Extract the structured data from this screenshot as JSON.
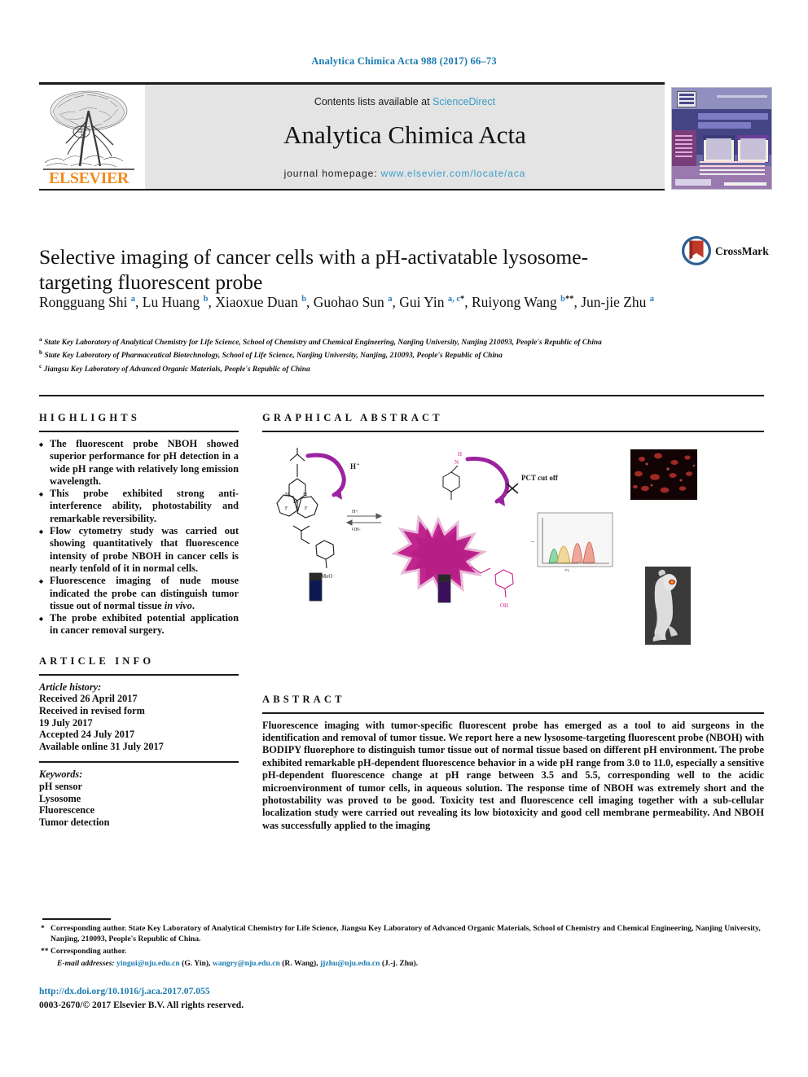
{
  "running_head": "Analytica Chimica Acta 988 (2017) 66–73",
  "masthead": {
    "publisher": "ELSEVIER",
    "contents_prefix": "Contents lists available at ",
    "contents_link": "ScienceDirect",
    "journal_name": "Analytica Chimica Acta",
    "homepage_prefix": "journal homepage: ",
    "homepage_link": "www.elsevier.com/locate/aca"
  },
  "crossmark": {
    "label": "CrossMark"
  },
  "article": {
    "title": "Selective imaging of cancer cells with a pH-activatable lysosome-targeting fluorescent probe",
    "authors": [
      {
        "name": "Rongguang Shi",
        "marks": "a",
        "sep": ", "
      },
      {
        "name": "Lu Huang",
        "marks": "b",
        "sep": ", "
      },
      {
        "name": "Xiaoxue Duan",
        "marks": "b",
        "sep": ", "
      },
      {
        "name": "Guohao Sun",
        "marks": "a",
        "sep": ", "
      },
      {
        "name": "Gui Yin",
        "marks": "a, c",
        "star": "*",
        "sep": ", "
      },
      {
        "name": "Ruiyong Wang",
        "marks": "b",
        "star": "**",
        "sep": ", "
      },
      {
        "name": "Jun-jie Zhu",
        "marks": "a",
        "sep": ""
      }
    ],
    "affiliations": [
      {
        "mark": "a",
        "text": "State Key Laboratory of Analytical Chemistry for Life Science, School of Chemistry and Chemical Engineering, Nanjing University, Nanjing 210093, People's Republic of China"
      },
      {
        "mark": "b",
        "text": "State Key Laboratory of Pharmaceutical Biotechnology, School of Life Science, Nanjing University, Nanjing, 210093, People's Republic of China"
      },
      {
        "mark": "c",
        "text": "Jiangsu Key Laboratory of Advanced Organic Materials, People's Republic of China"
      }
    ]
  },
  "highlights": {
    "heading": "HIGHLIGHTS",
    "items": [
      "The fluorescent probe NBOH showed superior performance for pH detection in a wide pH range with relatively long emission wavelength.",
      "This probe exhibited strong anti-interference ability, photostability and remarkable reversibility.",
      "Flow cytometry study was carried out showing quantitatively that fluorescence intensity of probe NBOH in cancer cells is nearly tenfold of it in normal cells.",
      "Fluorescence imaging of nude mouse indicated the probe can distinguish tumor tissue out of normal tissue in vivo.",
      "The probe exhibited potential application in cancer removal surgery."
    ]
  },
  "graphical_abstract": {
    "heading": "GRAPHICAL ABSTRACT"
  },
  "article_info": {
    "heading": "ARTICLE INFO",
    "history_label": "Article history:",
    "history": [
      "Received 26 April 2017",
      "Received in revised form",
      "19 July 2017",
      "Accepted 24 July 2017",
      "Available online 31 July 2017"
    ],
    "keywords_label": "Keywords:",
    "keywords": [
      "pH sensor",
      "Lysosome",
      "Fluorescence",
      "Tumor detection"
    ]
  },
  "abstract": {
    "heading": "ABSTRACT",
    "text": "Fluorescence imaging with tumor-specific fluorescent probe has emerged as a tool to aid surgeons in the identification and removal of tumor tissue. We report here a new lysosome-targeting fluorescent probe (NBOH) with BODIPY fluorephore to distinguish tumor tissue out of normal tissue based on different pH environment. The probe exhibited remarkable pH-dependent fluorescence behavior in a wide pH range from 3.0 to 11.0, especially a sensitive pH-dependent fluorescence change at pH range between 3.5 and 5.5, corresponding well to the acidic microenvironment of tumor cells, in aqueous solution. The response time of NBOH was extremely short and the photostability was proved to be good. Toxicity test and fluorescence cell imaging together with a sub-cellular localization study were carried out revealing its low biotoxicity and good cell membrane permeability. And NBOH was successfully applied to the imaging"
  },
  "footnotes": {
    "corresponding_1_mark": "*",
    "corresponding_1": "Corresponding author. State Key Laboratory of Analytical Chemistry for Life Science, Jiangsu Key Laboratory of Advanced Organic Materials, School of Chemistry and Chemical Engineering, Nanjing University, Nanjing, 210093, People's Republic of China.",
    "corresponding_2_mark": "**",
    "corresponding_2": "Corresponding author.",
    "emails_label": "E-mail addresses:",
    "emails": [
      {
        "address": "yingui@nju.edu.cn",
        "person": "(G. Yin)"
      },
      {
        "address": "wangry@nju.edu.cn",
        "person": "(R. Wang)"
      },
      {
        "address": "jjzhu@nju.edu.cn",
        "person": "(J.-j. Zhu)"
      }
    ],
    "doi": "http://dx.doi.org/10.1016/j.aca.2017.07.055",
    "copyright": "0003-2670/© 2017 Elsevier B.V. All rights reserved."
  },
  "colors": {
    "link_blue": "#1a7ab0",
    "sciencedirect_blue": "#3a9cc8",
    "elsevier_orange": "#f08c1e",
    "superscript_blue": "#2b7bb9",
    "masthead_grey": "#e4e4e4"
  }
}
